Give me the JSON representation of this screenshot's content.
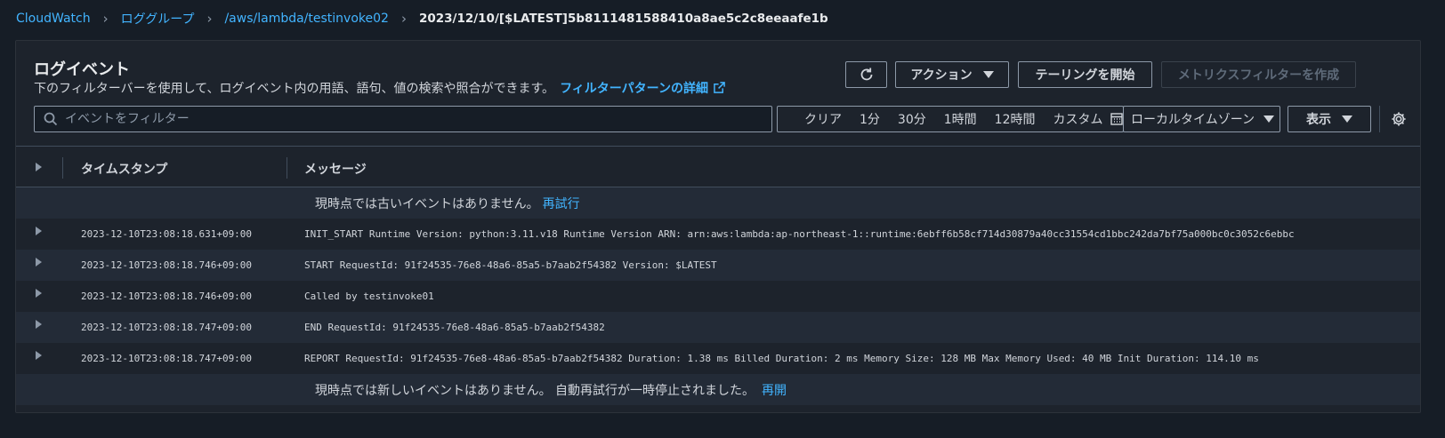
{
  "breadcrumb": {
    "items": [
      "CloudWatch",
      "ロググループ",
      "/aws/lambda/testinvoke02"
    ],
    "current": "2023/12/10/[$LATEST]5b8111481588410a8ae5c2c8eeaafe1b"
  },
  "header": {
    "title": "ログイベント",
    "description": "下のフィルターバーを使用して、ログイベント内の用語、語句、値の検索や照合ができます。",
    "help_link": "フィルターパターンの詳細"
  },
  "toolbar": {
    "actions_label": "アクション",
    "tail_label": "テーリングを開始",
    "metric_filter_label": "メトリクスフィルターを作成"
  },
  "filter": {
    "placeholder": "イベントをフィルター",
    "value": ""
  },
  "time_range": {
    "options": [
      "クリア",
      "1分",
      "30分",
      "1時間",
      "12時間"
    ],
    "custom_label": "カスタム"
  },
  "timezone": {
    "selected": "ローカルタイムゾーン"
  },
  "display": {
    "label": "表示"
  },
  "table": {
    "columns": [
      "タイムスタンプ",
      "メッセージ"
    ],
    "no_older": "現時点では古いイベントはありません。",
    "retry_label": "再試行",
    "no_newer": "現時点では新しいイベントはありません。 自動再試行が一時停止されました。",
    "resume_label": "再開",
    "rows": [
      {
        "timestamp": "2023-12-10T23:08:18.631+09:00",
        "message": "INIT_START Runtime Version: python:3.11.v18 Runtime Version ARN: arn:aws:lambda:ap-northeast-1::runtime:6ebff6b58cf714d30879a40cc31554cd1bbc242da7bf75a000bc0c3052c6ebbc"
      },
      {
        "timestamp": "2023-12-10T23:08:18.746+09:00",
        "message": "START RequestId: 91f24535-76e8-48a6-85a5-b7aab2f54382 Version: $LATEST"
      },
      {
        "timestamp": "2023-12-10T23:08:18.746+09:00",
        "message": "Called by testinvoke01"
      },
      {
        "timestamp": "2023-12-10T23:08:18.747+09:00",
        "message": "END RequestId: 91f24535-76e8-48a6-85a5-b7aab2f54382"
      },
      {
        "timestamp": "2023-12-10T23:08:18.747+09:00",
        "message": "REPORT RequestId: 91f24535-76e8-48a6-85a5-b7aab2f54382 Duration: 1.38 ms Billed Duration: 2 ms Memory Size: 128 MB Max Memory Used: 40 MB Init Duration: 114.10 ms"
      }
    ]
  },
  "colors": {
    "link": "#42b4ff",
    "background": "#161d26",
    "panel": "#1d232c"
  }
}
